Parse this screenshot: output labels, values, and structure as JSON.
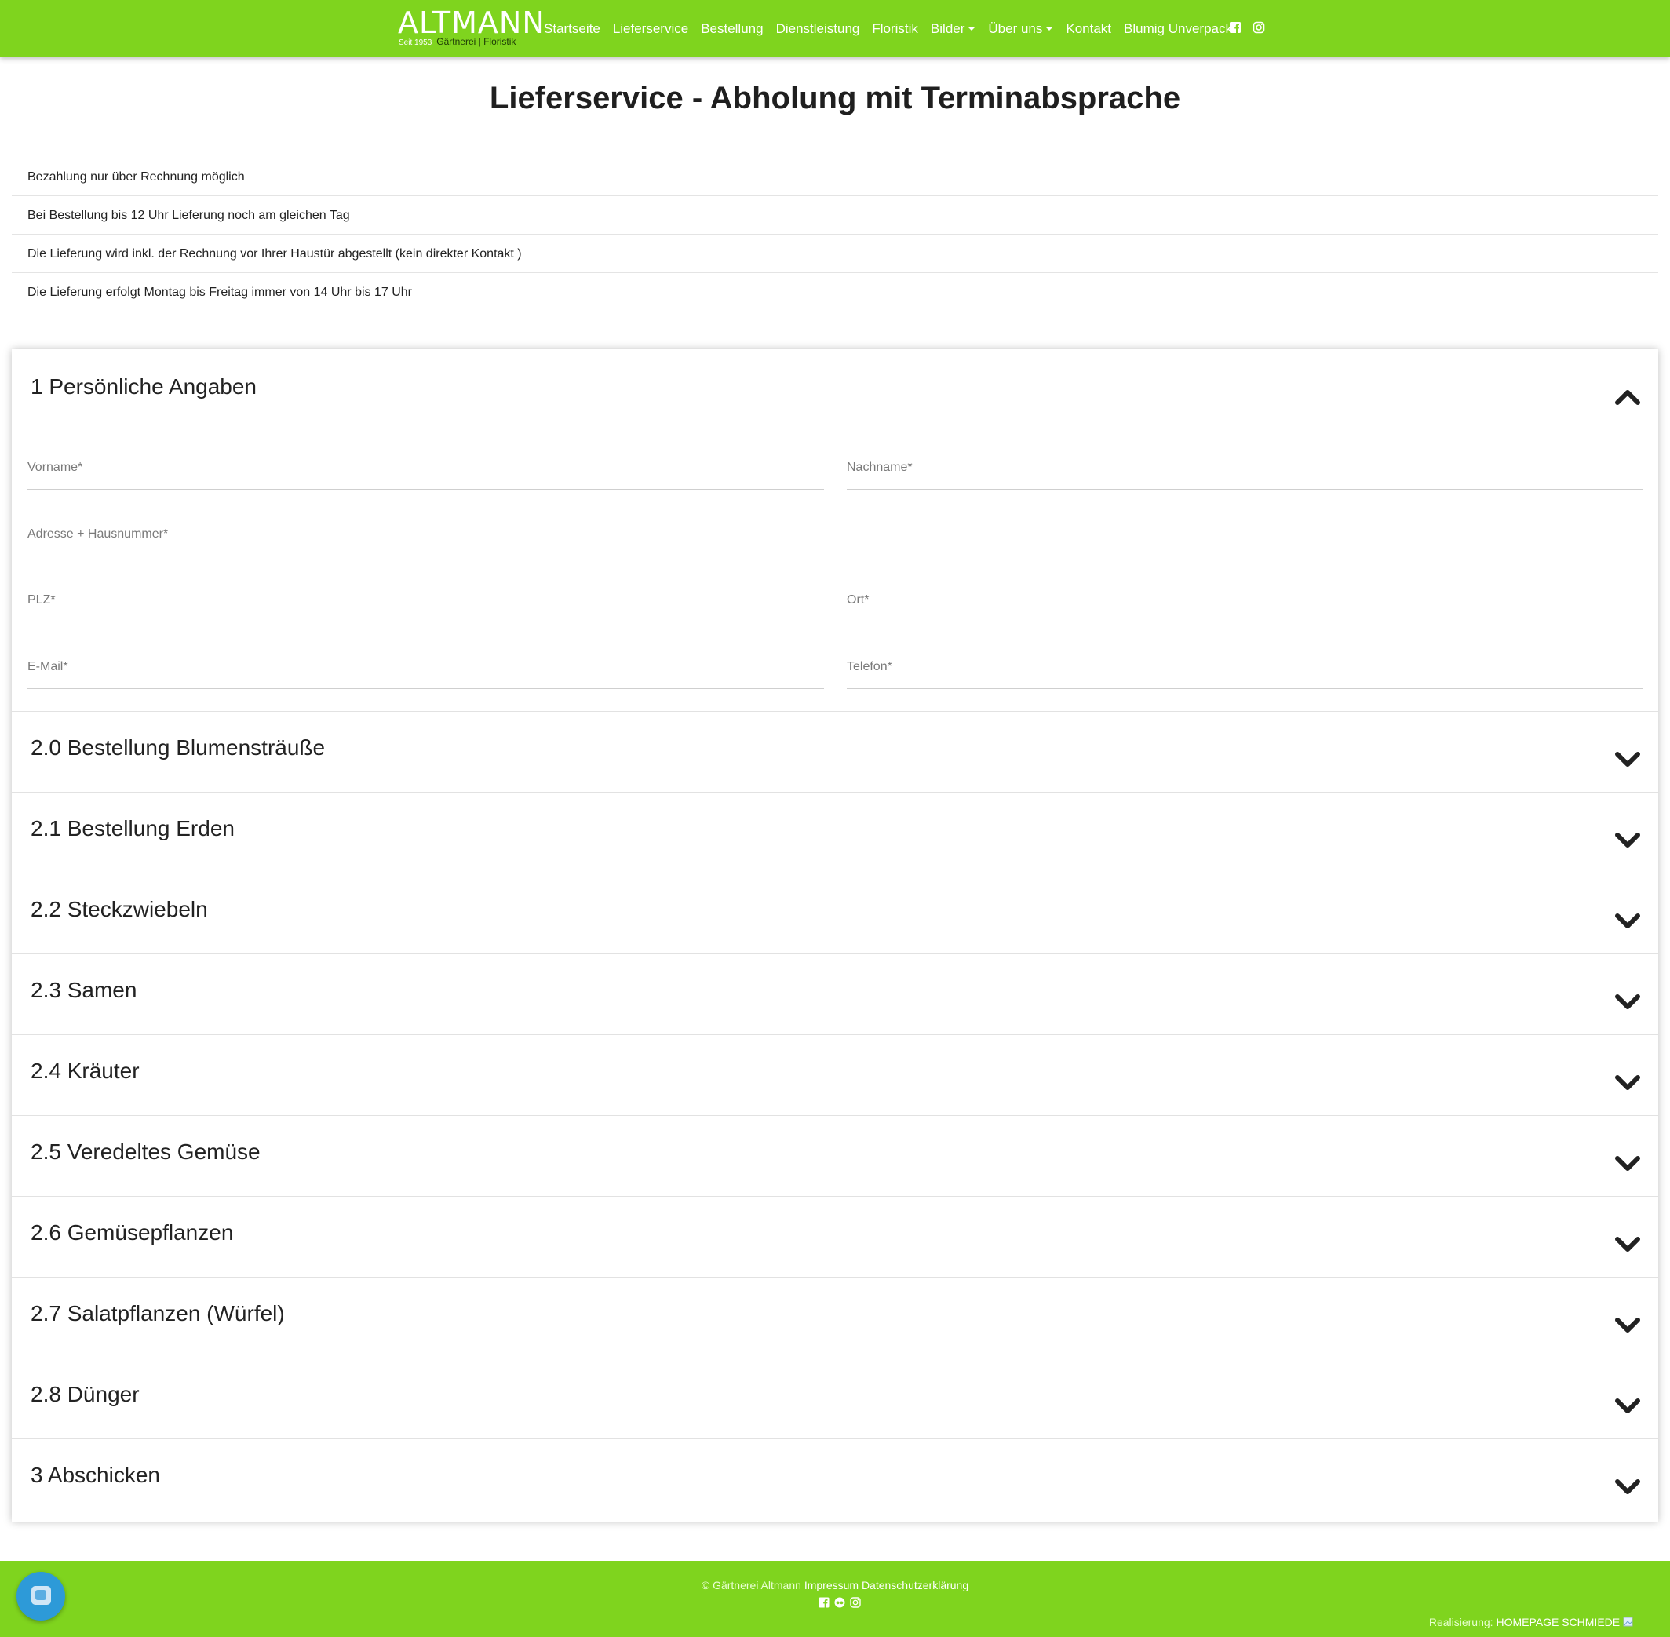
{
  "brand": {
    "name": "ALTMANN",
    "since": "Seit 1953",
    "tagline": "Gärtnerei | Floristik"
  },
  "nav": {
    "items": [
      {
        "label": "Startseite"
      },
      {
        "label": "Lieferservice"
      },
      {
        "label": "Bestellung"
      },
      {
        "label": "Dienstleistung"
      },
      {
        "label": "Floristik"
      },
      {
        "label": "Bilder",
        "dropdown": true
      },
      {
        "label": "Über uns",
        "dropdown": true
      },
      {
        "label": "Kontakt"
      },
      {
        "label": "Blumig Unverpackt"
      }
    ],
    "social": [
      "facebook-icon",
      "instagram-icon"
    ]
  },
  "page": {
    "title": "Lieferservice - Abholung mit Terminabsprache"
  },
  "info": [
    "Bezahlung nur über Rechnung möglich",
    "Bei Bestellung bis 12 Uhr Lieferung noch am gleichen Tag",
    "Die Lieferung wird inkl. der Rechnung vor Ihrer Haustür abgestellt (kein direkter Kontakt )",
    "Die Lieferung erfolgt Montag bis Freitag immer von 14 Uhr bis 17 Uhr"
  ],
  "form": {
    "section1": {
      "title": "1 Persönliche Angaben",
      "expanded": true,
      "fields": {
        "vorname": {
          "placeholder": "Vorname*",
          "value": ""
        },
        "nachname": {
          "placeholder": "Nachname*",
          "value": ""
        },
        "adresse": {
          "placeholder": "Adresse + Hausnummer*",
          "value": ""
        },
        "plz": {
          "placeholder": "PLZ*",
          "value": ""
        },
        "ort": {
          "placeholder": "Ort*",
          "value": ""
        },
        "email": {
          "placeholder": "E-Mail*",
          "value": ""
        },
        "telefon": {
          "placeholder": "Telefon*",
          "value": ""
        }
      }
    },
    "sections": [
      {
        "title": "2.0 Bestellung Blumensträuße"
      },
      {
        "title": "2.1 Bestellung Erden"
      },
      {
        "title": "2.2 Steckzwiebeln"
      },
      {
        "title": "2.3 Samen"
      },
      {
        "title": "2.4 Kräuter"
      },
      {
        "title": "2.5 Veredeltes Gemüse"
      },
      {
        "title": "2.6 Gemüsepflanzen"
      },
      {
        "title": "2.7 Salatpflanzen (Würfel)"
      },
      {
        "title": "2.8 Dünger"
      },
      {
        "title": "3 Abschicken"
      }
    ]
  },
  "footer": {
    "copyright": "© Gärtnerei Altmann",
    "impressum": "Impressum",
    "datenschutz": "Datenschutzerklärung",
    "realisierung_label": "Realisierung:",
    "realisierung_link": "HOMEPAGE SCHMIEDE"
  },
  "colors": {
    "brand_green": "#7fd41e",
    "chat_blue": "#2d9ad8",
    "text": "#222222"
  }
}
